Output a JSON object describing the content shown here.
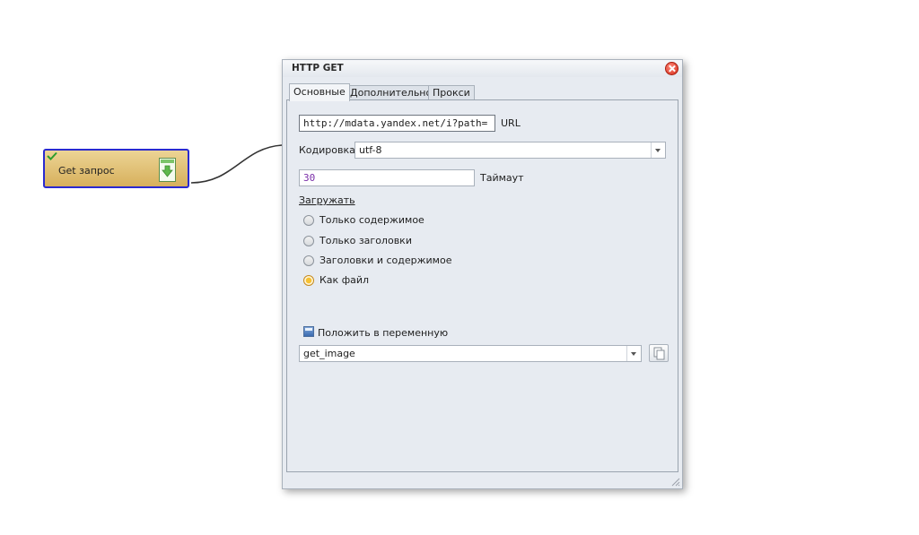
{
  "node": {
    "label": "Get запрос",
    "check_icon": "check-icon",
    "icon": "http-get-download-icon"
  },
  "dialog": {
    "title": "HTTP GET",
    "close_icon": "close-icon",
    "tabs": [
      {
        "label": "Основные",
        "active": true
      },
      {
        "label": "Дополнительно",
        "active": false
      },
      {
        "label": "Прокси",
        "active": false
      }
    ],
    "url": {
      "value": "http://mdata.yandex.net/i?path=",
      "label": "URL"
    },
    "encoding": {
      "label": "Кодировка",
      "value": "utf-8"
    },
    "timeout": {
      "value": "30",
      "label": "Таймаут"
    },
    "load": {
      "label": "Загружать",
      "options": [
        {
          "label": "Только содержимое",
          "checked": false
        },
        {
          "label": "Только заголовки",
          "checked": false
        },
        {
          "label": "Заголовки и содержимое",
          "checked": false
        },
        {
          "label": "Как файл",
          "checked": true
        }
      ]
    },
    "variable": {
      "checkbox_label": "Положить в переменную",
      "value": "get_image"
    }
  },
  "colors": {
    "node_border": "#2a2ad0",
    "node_fill": "#d7b05c",
    "timeout_text": "#7a2ea8"
  }
}
